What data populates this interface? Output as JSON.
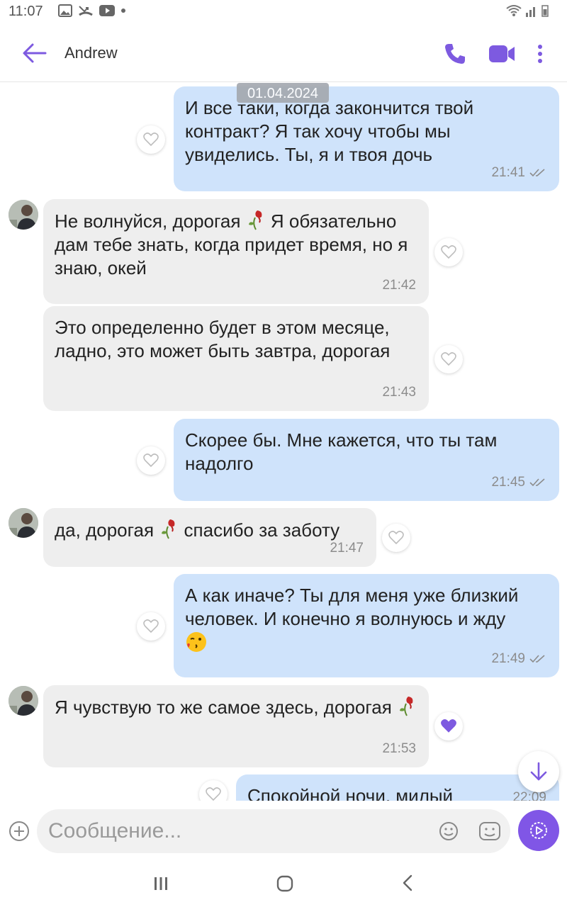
{
  "status_bar": {
    "time": "11:07"
  },
  "header": {
    "contact_name": "Andrew"
  },
  "chat": {
    "date_chip": "01.04.2024",
    "messages": [
      {
        "direction": "outgoing",
        "text": "И все таки, когда закончится твой контракт? Я так хочу чтобы мы увиделись. Ты, я и твоя дочь",
        "time": "21:41",
        "status": "read",
        "liked": false
      },
      {
        "direction": "incoming",
        "text": "Не волнуйся, дорогая",
        "text_after_emoji": " Я обязательно дам тебе знать, когда придет время, но я знаю, окей",
        "emoji": "wilted-rose",
        "time": "21:42",
        "liked": false
      },
      {
        "direction": "incoming",
        "text": "Это определенно будет в этом месяце, ладно, это может быть завтра, дорогая",
        "time": "21:43",
        "liked": false
      },
      {
        "direction": "outgoing",
        "text": "Скорее бы. Мне кажется, что ты там надолго",
        "time": "21:45",
        "status": "read",
        "liked": false
      },
      {
        "direction": "incoming",
        "text": "да, дорогая",
        "text_after_emoji": " спасибо за заботу",
        "emoji": "wilted-rose",
        "time": "21:47",
        "liked": false
      },
      {
        "direction": "outgoing",
        "text": "А как иначе? Ты для меня уже близкий человек. И конечно я волнуюсь и жду",
        "emoji": "kissing-face",
        "time": "21:49",
        "status": "read",
        "liked": false
      },
      {
        "direction": "incoming",
        "text": "Я чувствую то же самое здесь, дорогая",
        "emoji": "wilted-rose",
        "time": "21:53",
        "liked": true
      },
      {
        "direction": "outgoing",
        "text": "Спокойной ночи, милый",
        "time": "22:09",
        "liked": false
      }
    ]
  },
  "composer": {
    "placeholder": "Сообщение..."
  },
  "colors": {
    "accent": "#8056e6",
    "outgoing_bubble": "#cfe3fb",
    "incoming_bubble": "#eeeeee"
  }
}
